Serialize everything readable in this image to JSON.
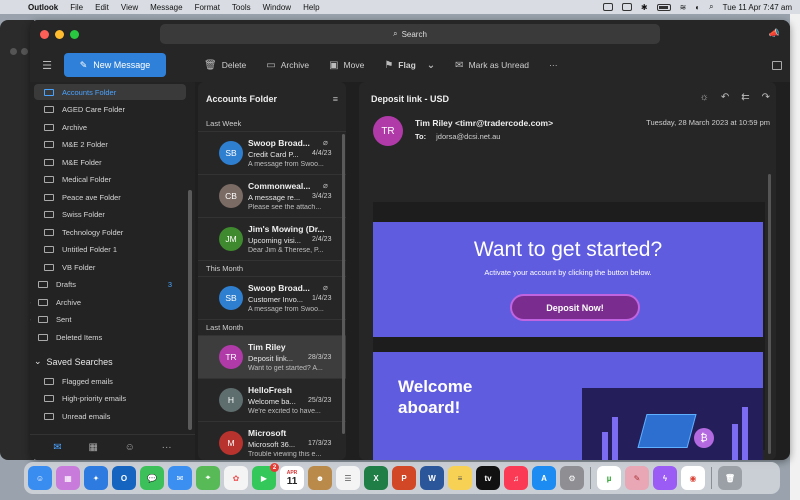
{
  "menubar": {
    "app_name": "Outlook",
    "menus": [
      "File",
      "Edit",
      "View",
      "Message",
      "Format",
      "Tools",
      "Window",
      "Help"
    ],
    "datetime": "Tue 11 Apr  7:47 am"
  },
  "titlebar": {
    "search_placeholder": "Search"
  },
  "toolbar": {
    "new_message": "New Message",
    "delete": "Delete",
    "archive": "Archive",
    "move": "Move",
    "flag": "Flag",
    "mark_unread": "Mark as Unread",
    "more": "···"
  },
  "folders": {
    "items": [
      {
        "label": "Accounts Folder"
      },
      {
        "label": "AGED Care Folder"
      },
      {
        "label": "Archive"
      },
      {
        "label": "M&E 2 Folder"
      },
      {
        "label": "M&E Folder"
      },
      {
        "label": "Medical Folder"
      },
      {
        "label": "Peace ave Folder"
      },
      {
        "label": "Swiss Folder"
      },
      {
        "label": "Technology  Folder"
      },
      {
        "label": "Untitled Folder 1"
      },
      {
        "label": "VB Folder"
      }
    ],
    "drafts": {
      "label": "Drafts",
      "count": "3"
    },
    "archive2": "Archive",
    "sent": "Sent",
    "deleted": "Deleted Items",
    "saved_searches": {
      "title": "Saved Searches",
      "items": [
        "Flagged emails",
        "High-priority emails",
        "Unread emails"
      ]
    }
  },
  "list": {
    "title": "Accounts Folder",
    "groups": {
      "last_week": "Last Week",
      "this_month": "This Month",
      "last_month": "Last Month"
    },
    "messages": [
      {
        "initials": "SB",
        "color": "#2f7fd1",
        "from": "Swoop Broad...",
        "subject": "Credit Card P...",
        "date": "4/4/23",
        "preview": "A message from Swoo...",
        "attach": true
      },
      {
        "initials": "CB",
        "color": "#7a6b64",
        "from": "Commonweal...",
        "subject": "A message re...",
        "date": "3/4/23",
        "preview": "Please see the attach...",
        "attach": true
      },
      {
        "initials": "JM",
        "color": "#3f8a2e",
        "from": "Jim's Mowing (Dr...",
        "subject": "Upcoming visi...",
        "date": "2/4/23",
        "preview": "Dear Jim & Therese, P...",
        "attach": false
      },
      {
        "initials": "SB",
        "color": "#2f7fd1",
        "from": "Swoop Broad...",
        "subject": "Customer Invo...",
        "date": "1/4/23",
        "preview": "A message from Swoo...",
        "attach": true
      },
      {
        "initials": "TR",
        "color": "#b03aa8",
        "from": "Tim Riley",
        "subject": "Deposit link...",
        "date": "28/3/23",
        "preview": "Want to get started? A...",
        "attach": false
      },
      {
        "initials": "H",
        "color": "#5e6d6e",
        "from": "HelloFresh",
        "subject": "Welcome ba...",
        "date": "25/3/23",
        "preview": "We're excited to have...",
        "attach": false
      },
      {
        "initials": "M",
        "color": "#b8332d",
        "from": "Microsoft",
        "subject": "Microsoft 36...",
        "date": "17/3/23",
        "preview": "Trouble viewing this e...",
        "attach": false
      }
    ]
  },
  "reader": {
    "subject": "Deposit link - USD",
    "avatar": "TR",
    "from": "Tim Riley <timr@tradercode.com>",
    "to_label": "To:",
    "to": "jdorsa@dcsi.net.au",
    "date": "Tuesday, 28 March 2023 at 10:59 pm",
    "body": {
      "heading": "Want to get started?",
      "subtext": "Activate your account by clicking the button below.",
      "button": "Deposit Now!",
      "welcome": "Welcome aboard!"
    }
  },
  "dock": {
    "calendar_month": "APR",
    "calendar_day": "11",
    "facetime_badge": "2",
    "appletv": "tv"
  },
  "colors": {
    "accent": "#2f80d8",
    "banner": "#5f5ce0",
    "button": "#7b2d8f"
  }
}
